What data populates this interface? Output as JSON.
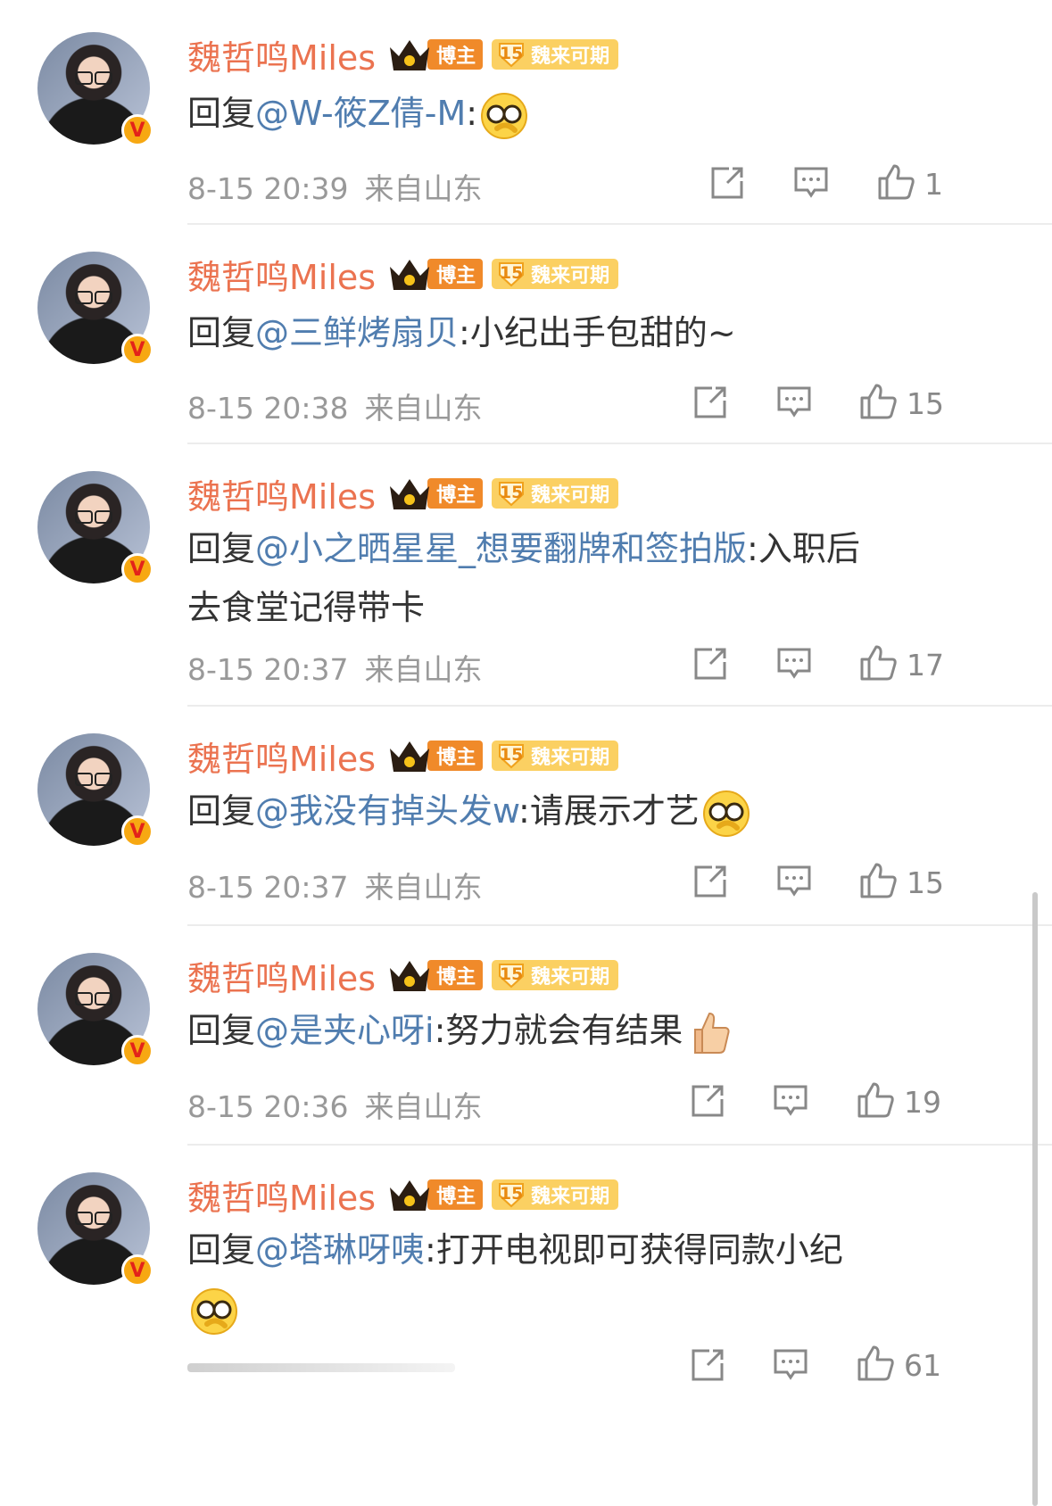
{
  "comments": [
    {
      "username": "魏哲鸣Miles",
      "badge_blogger": "博主",
      "fan_level": "15",
      "fan_badge": "魏来可期",
      "reply_prefix": "回复",
      "mention": "@W-筱Z倩-M",
      "colon": ":",
      "body_line1": "",
      "body_line2": "",
      "emoji": "smirk-emoji",
      "date": "8-15 20:39",
      "location": "来自山东",
      "likes": "1"
    },
    {
      "username": "魏哲鸣Miles",
      "badge_blogger": "博主",
      "fan_level": "15",
      "fan_badge": "魏来可期",
      "reply_prefix": "回复",
      "mention": "@三鲜烤扇贝",
      "colon": ":",
      "body_line1": "小纪出手包甜的~",
      "body_line2": "",
      "emoji": "",
      "date": "8-15 20:38",
      "location": "来自山东",
      "likes": "15"
    },
    {
      "username": "魏哲鸣Miles",
      "badge_blogger": "博主",
      "fan_level": "15",
      "fan_badge": "魏来可期",
      "reply_prefix": "回复",
      "mention": "@小之晒星星_想要翻牌和签拍版",
      "colon": ":",
      "body_line1": "入职后",
      "body_line2": "去食堂记得带卡",
      "emoji": "",
      "date": "8-15 20:37",
      "location": "来自山东",
      "likes": "17"
    },
    {
      "username": "魏哲鸣Miles",
      "badge_blogger": "博主",
      "fan_level": "15",
      "fan_badge": "魏来可期",
      "reply_prefix": "回复",
      "mention": "@我没有掉头发w",
      "colon": ":",
      "body_line1": "请展示才艺",
      "body_line2": "",
      "emoji": "smirk-emoji",
      "date": "8-15 20:37",
      "location": "来自山东",
      "likes": "15"
    },
    {
      "username": "魏哲鸣Miles",
      "badge_blogger": "博主",
      "fan_level": "15",
      "fan_badge": "魏来可期",
      "reply_prefix": "回复",
      "mention": "@是夹心呀i",
      "colon": ":",
      "body_line1": "努力就会有结果",
      "body_line2": "",
      "emoji": "thumbs-up-emoji",
      "date": "8-15 20:36",
      "location": "来自山东",
      "likes": "19"
    },
    {
      "username": "魏哲鸣Miles",
      "badge_blogger": "博主",
      "fan_level": "15",
      "fan_badge": "魏来可期",
      "reply_prefix": "回复",
      "mention": "@塔琳呀咦",
      "colon": ":",
      "body_line1": "打开电视即可获得同款小纪",
      "body_line2": "",
      "emoji": "smirk-emoji",
      "date": "",
      "location": "",
      "likes": "61"
    }
  ],
  "colors": {
    "username": "#eb7350",
    "mention": "#507daf",
    "meta": "#999999",
    "icon": "#888888"
  },
  "icons": {
    "share": "share-icon",
    "comment": "comment-icon",
    "like": "like-icon",
    "verified": "verified-v-icon",
    "crown": "crown-icon"
  }
}
